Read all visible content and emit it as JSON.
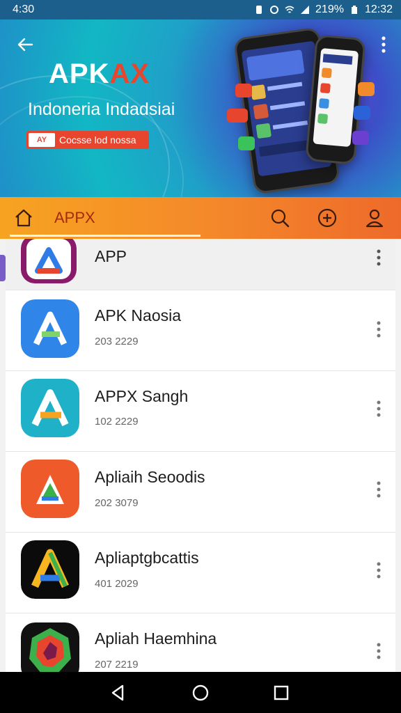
{
  "status_bar": {
    "time": "4:30",
    "battery_percent": "219%",
    "clock": "12:32"
  },
  "banner": {
    "brand_main": "APK",
    "brand_accent": "AX",
    "tagline": "Indoneria Indadsiai",
    "promo_text": "Cocsse lod nossa",
    "promo_badge": "AY"
  },
  "navbar": {
    "title": "APPX"
  },
  "apps": [
    {
      "name": "APP",
      "date": ""
    },
    {
      "name": "APK Naosia",
      "date": "203 2229"
    },
    {
      "name": "APPX Sangh",
      "date": "102 2229"
    },
    {
      "name": "Apliaih Seoodis",
      "date": "202 3079"
    },
    {
      "name": "Apliaptgbcattis",
      "date": "401 2029"
    },
    {
      "name": "Apliah Haemhina",
      "date": "207 2219"
    }
  ],
  "colors": {
    "status_bar": "#1d5f8c",
    "accent_red": "#e8452f",
    "nav_orange": "#f48a2a",
    "nav_title": "#a42b10"
  },
  "icons": {
    "back": "arrow-left-icon",
    "more": "more-vertical-icon",
    "home": "home-icon",
    "search": "search-icon",
    "add": "plus-circle-icon",
    "profile": "user-icon"
  }
}
